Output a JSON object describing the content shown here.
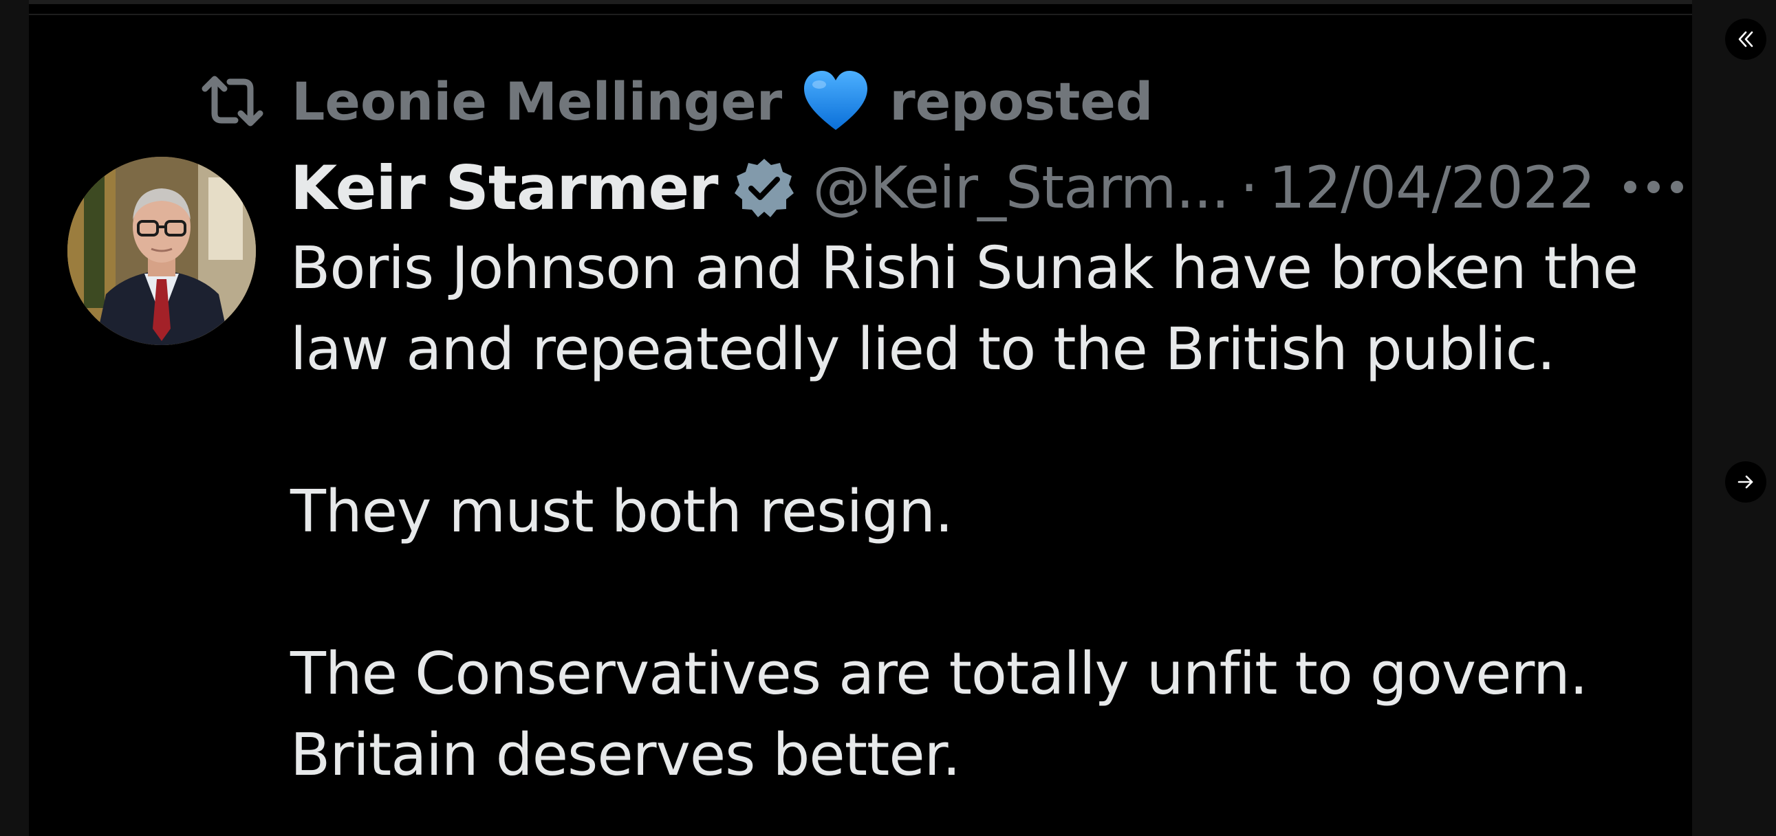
{
  "repost": {
    "user_name": "Leonie Mellinger",
    "heart_icon": "blue-heart-emoji",
    "label": "reposted",
    "icon": "repost-icon"
  },
  "tweet": {
    "display_name": "Keir Starmer",
    "verified_icon": "verified-badge-icon",
    "handle": "@Keir_Starm...",
    "separator": "·",
    "date": "12/04/2022",
    "more_icon": "more-options-icon",
    "lines": [
      "Boris Johnson and Rishi Sunak have broken the",
      "law and repeatedly lied to the British public.",
      "They must both resign.",
      "The Conservatives are totally unfit to govern.",
      "Britain deserves better."
    ]
  },
  "viewer_controls": {
    "collapse_icon": "double-chevron-left-icon",
    "next_icon": "arrow-right-icon"
  },
  "colors": {
    "background": "#000000",
    "primary_text": "#e7e9ea",
    "secondary_text": "#71767b",
    "verified_badge": "#829aab",
    "heart": "#1d8cf5"
  }
}
